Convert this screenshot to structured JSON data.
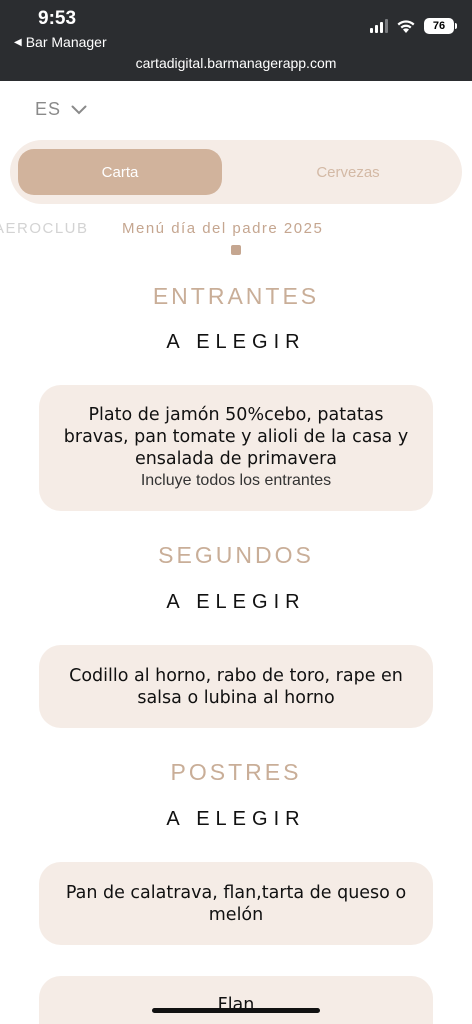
{
  "status": {
    "time": "9:53",
    "back_app": "Bar Manager",
    "battery": "76",
    "url": "cartadigital.barmanagerapp.com"
  },
  "language": {
    "selected": "ES"
  },
  "tabs": [
    {
      "label": "Carta",
      "active": true
    },
    {
      "label": "Cervezas",
      "active": false
    }
  ],
  "submenus": [
    {
      "label": "AEROCLUB"
    },
    {
      "label": "Menú día del padre 2025"
    }
  ],
  "sections": [
    {
      "title": "ENTRANTES",
      "subtitle": "A ELEGIR",
      "card": {
        "text": "Plato de jamón 50%cebo, patatas bravas, pan tomate y alioli de la casa y ensalada de primavera",
        "note": "Incluye todos los entrantes"
      }
    },
    {
      "title": "SEGUNDOS",
      "subtitle": "A ELEGIR",
      "card": {
        "text": "Codillo al horno, rabo de toro, rape en salsa o lubina al horno"
      }
    },
    {
      "title": "POSTRES",
      "subtitle": "A ELEGIR",
      "card": {
        "text": "Pan de calatrava, flan,tarta de queso o melón"
      }
    }
  ],
  "extra_card": {
    "text": "Flan"
  },
  "colors": {
    "accent": "#d1b39c",
    "accent_text": "#c9ae98",
    "card_bg": "#f5ece6",
    "topbar": "#2b2d30"
  },
  "icons": {
    "language_toggle": "chevron-down-icon",
    "back": "back-triangle-icon",
    "signal": "signal-icon",
    "wifi": "wifi-icon",
    "battery": "battery-icon"
  }
}
